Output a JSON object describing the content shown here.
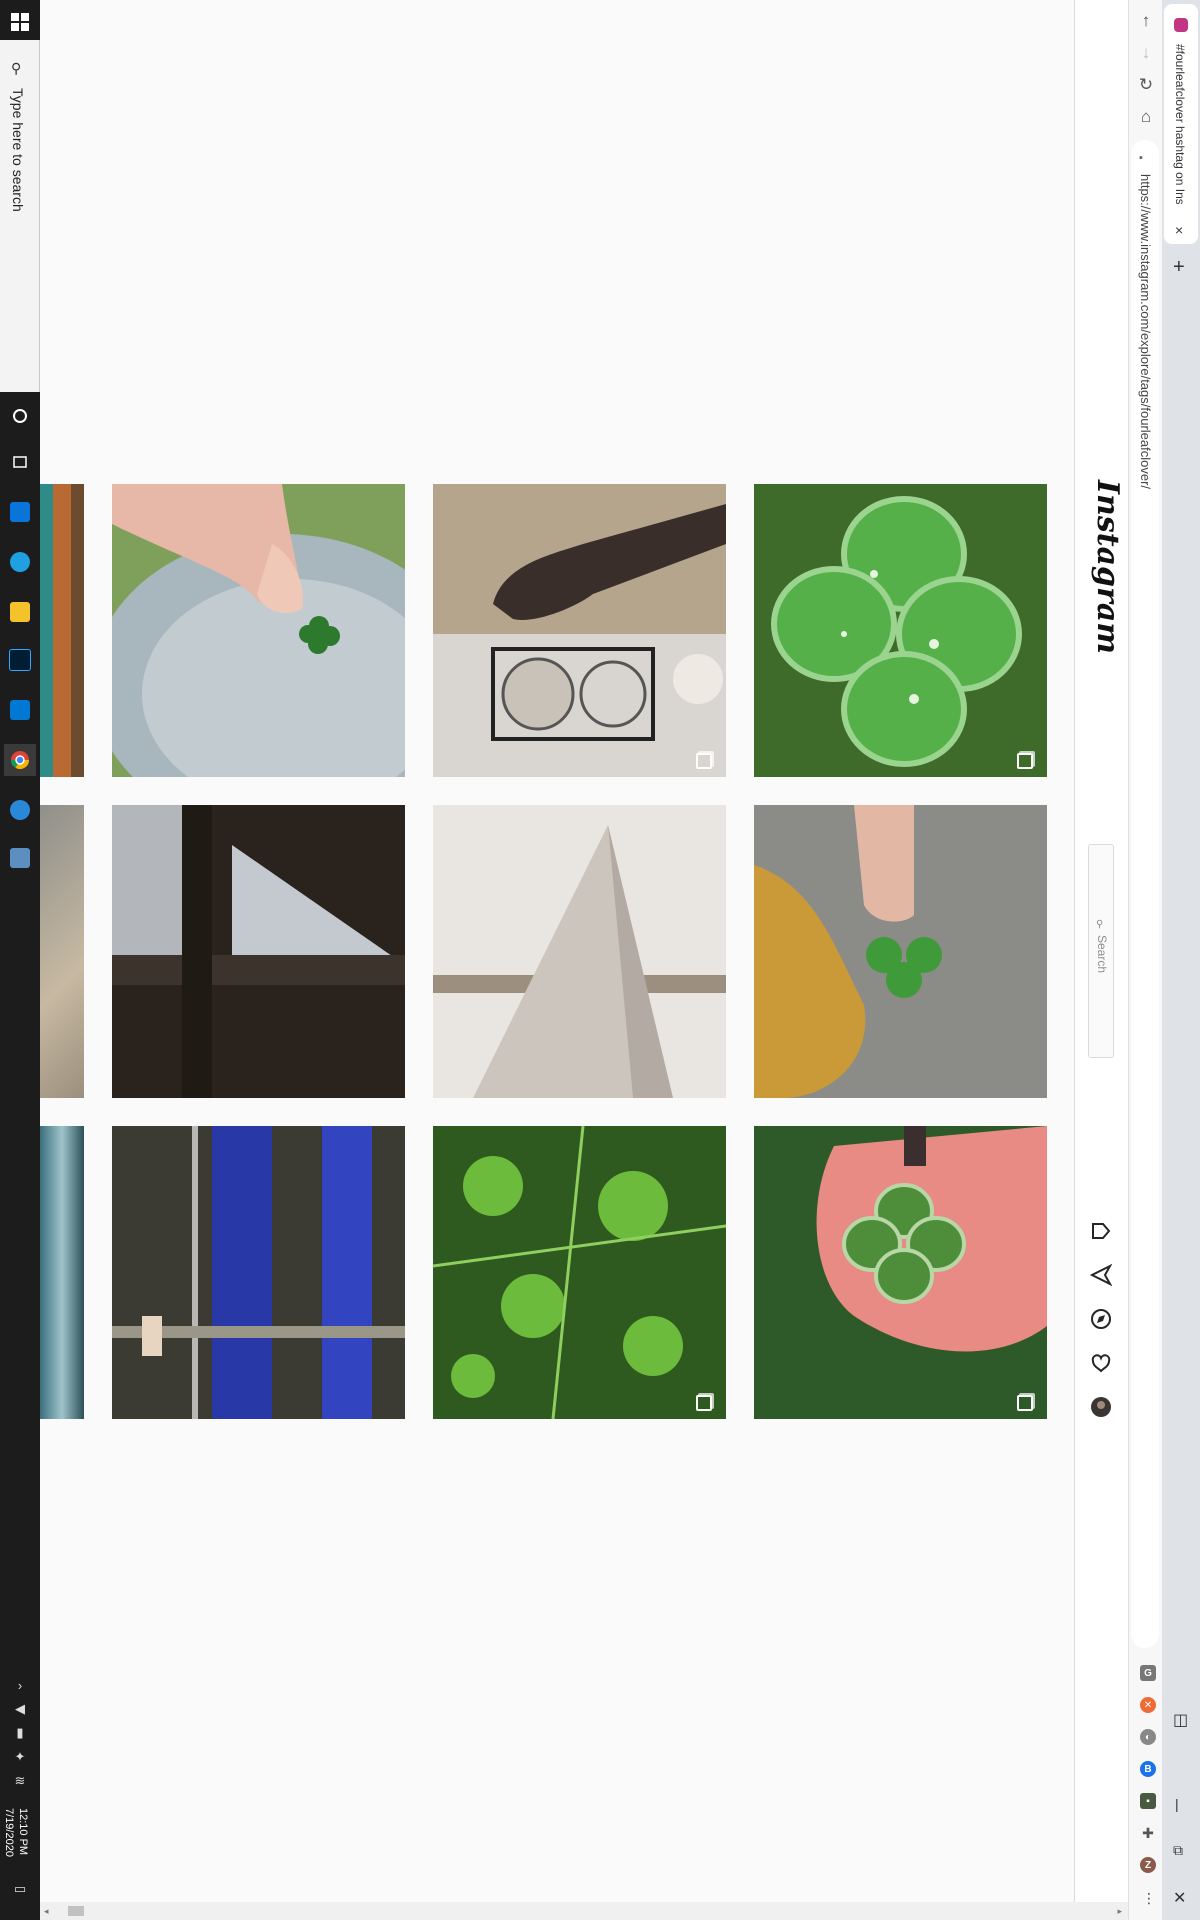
{
  "taskbar": {
    "search_placeholder": "Type here to search",
    "clock_time": "12:10 PM",
    "clock_date": "7/19/2020"
  },
  "browser": {
    "tab_title": "#fourleafclover hashtag on Insta",
    "url": "https://www.instagram.com/explore/tags/fourleafclover/",
    "new_tab_label": "+",
    "close_tab_label": "×",
    "extension_letters": [
      "G",
      "",
      "",
      "B",
      "",
      "",
      "Z"
    ],
    "accent_color": "#c13584"
  },
  "instagram": {
    "logo_text": "Instagram",
    "search_placeholder": "Search",
    "nav_icons": [
      "home-icon",
      "direct-message-icon",
      "explore-icon",
      "activity-heart-icon",
      "profile-avatar"
    ]
  },
  "grid": {
    "rows": [
      [
        {
          "label": "hand holding four leaf clover",
          "multi": false
        },
        {
          "label": "cat shadow and food bowls",
          "multi": true
        },
        {
          "label": "four leaf clover with dew",
          "multi": true
        }
      ],
      [
        {
          "label": "dark window frame",
          "multi": false
        },
        {
          "label": "white triangle shelf",
          "multi": false
        },
        {
          "label": "fingers holding clover",
          "multi": false
        }
      ],
      [
        {
          "label": "glass building reflection",
          "multi": false
        },
        {
          "label": "clover patch in grass",
          "multi": true
        },
        {
          "label": "clover in palm",
          "multi": true
        }
      ]
    ]
  }
}
